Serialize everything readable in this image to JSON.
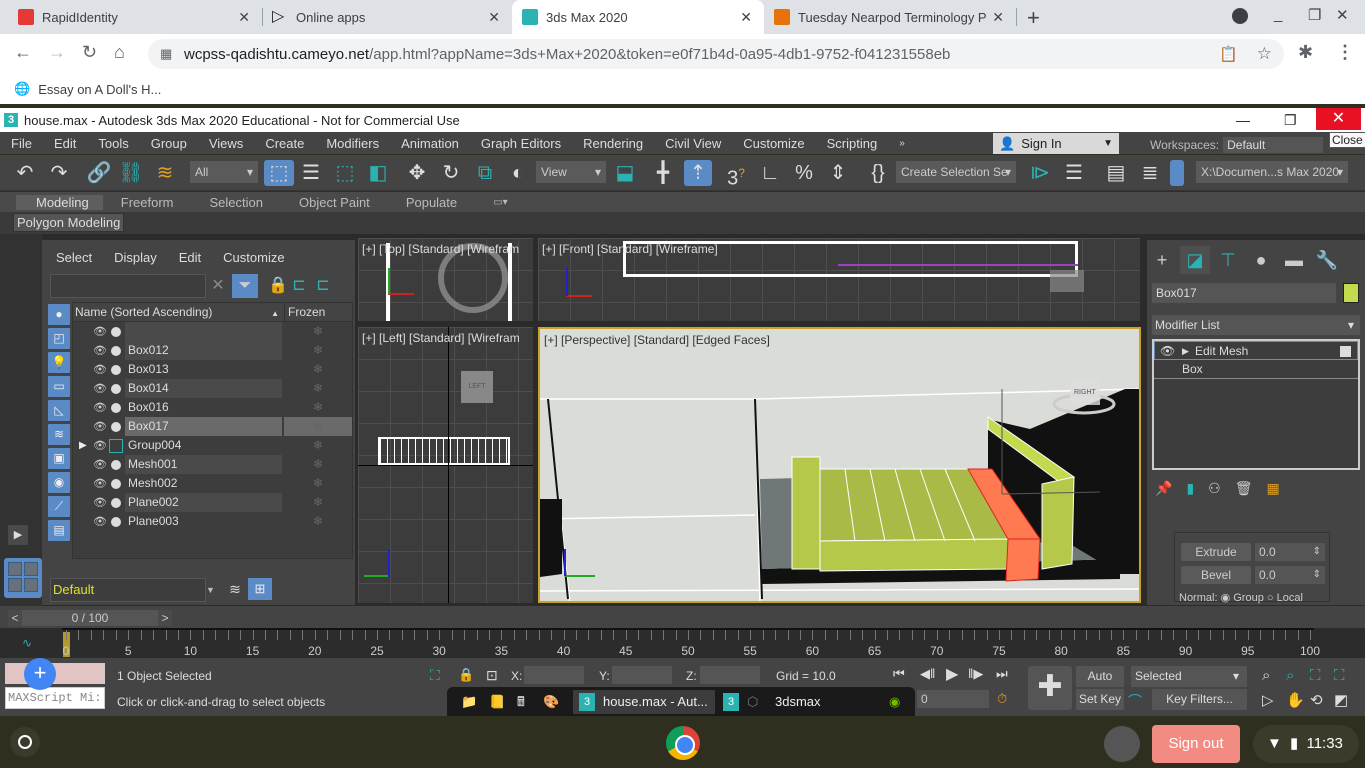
{
  "browser": {
    "tabs": [
      {
        "label": "RapidIdentity",
        "active": false,
        "favicon_color": "#e53935"
      },
      {
        "label": "Online apps",
        "active": false,
        "favicon_color": "#222222"
      },
      {
        "label": "3ds Max 2020",
        "active": true,
        "favicon_color": "#2bb3b3"
      },
      {
        "label": "Tuesday Nearpod Terminology P",
        "active": false,
        "favicon_color": "#e8710a"
      }
    ],
    "url_host": "wcpss-qadishtu.cameyo.net",
    "url_rest": "/app.html?appName=3ds+Max+2020&token=e0f71b4d-0a95-4db1-9752-f041231558eb",
    "bookmark": "Essay on A Doll's H..."
  },
  "app": {
    "title": "house.max - Autodesk 3ds Max 2020 Educational - Not for Commercial Use",
    "close_tooltip": "Close",
    "menu": [
      "File",
      "Edit",
      "Tools",
      "Group",
      "Views",
      "Create",
      "Modifiers",
      "Animation",
      "Graph Editors",
      "Rendering",
      "Civil View",
      "Customize",
      "Scripting"
    ],
    "sign_in": "Sign In",
    "workspaces_label": "Workspaces:",
    "workspaces_value": "Default",
    "toolbar": {
      "selection_filter": "All",
      "ref_coord": "View",
      "named_selection": "Create Selection Se",
      "project_path": "X:\\Documen...s Max 2020"
    },
    "ribbon_tabs": [
      "Modeling",
      "Freeform",
      "Selection",
      "Object Paint",
      "Populate"
    ],
    "ribbon_panel": "Polygon Modeling"
  },
  "explorer": {
    "menu": [
      "Select",
      "Display",
      "Edit",
      "Customize"
    ],
    "columns": [
      "Name (Sorted Ascending)",
      "Frozen"
    ],
    "rows": [
      {
        "name": "",
        "type": "object"
      },
      {
        "name": "Box012",
        "type": "object"
      },
      {
        "name": "Box013",
        "type": "object"
      },
      {
        "name": "Box014",
        "type": "object"
      },
      {
        "name": "Box016",
        "type": "object"
      },
      {
        "name": "Box017",
        "type": "object",
        "selected": true
      },
      {
        "name": "Group004",
        "type": "group"
      },
      {
        "name": "Mesh001",
        "type": "object"
      },
      {
        "name": "Mesh002",
        "type": "object"
      },
      {
        "name": "Plane002",
        "type": "object"
      },
      {
        "name": "Plane003",
        "type": "object"
      }
    ],
    "layer": "Default"
  },
  "viewports": {
    "top": "[+] [Top] [Standard] [Wirefram",
    "front": "[+] [Front] [Standard] [Wireframe]",
    "left": "[+] [Left] [Standard] [Wirefram",
    "perspective": "[+] [Perspective] [Standard] [Edged Faces]",
    "viewcube_persp": "RIGHT",
    "viewcube_left": "LEFT"
  },
  "command_panel": {
    "object_name": "Box017",
    "object_color": "#c3d94e",
    "modifier_list": "Modifier List",
    "stack": [
      "Edit Mesh",
      "Box"
    ],
    "extrude_label": "Extrude",
    "extrude_value": "0.0",
    "bevel_label": "Bevel",
    "bevel_value": "0.0",
    "normal_label": "Normal:",
    "normal_options": [
      "Group",
      "Local"
    ]
  },
  "timeline": {
    "frame_display": "0 / 100",
    "current_frame": 0,
    "range": [
      0,
      100
    ],
    "tick_labels": [
      0,
      5,
      10,
      15,
      20,
      25,
      30,
      35,
      40,
      45,
      50,
      55,
      60,
      65,
      70,
      75,
      80,
      85,
      90,
      95,
      100
    ]
  },
  "status": {
    "selection": "1 Object Selected",
    "prompt": "Click or click-and-drag to select objects",
    "maxscript": "MAXScript Mi:",
    "x_label": "X:",
    "y_label": "Y:",
    "z_label": "Z:",
    "grid": "Grid = 10.0",
    "frame_field": "0",
    "auto_key": "Auto Key",
    "set_key": "Set Key",
    "key_mode": "Selected",
    "key_filters": "Key Filters..."
  },
  "win_taskbar": {
    "items": [
      "house.max - Aut...",
      "3dsmax"
    ]
  },
  "shelf": {
    "sign_out": "Sign out",
    "time": "11:33"
  }
}
